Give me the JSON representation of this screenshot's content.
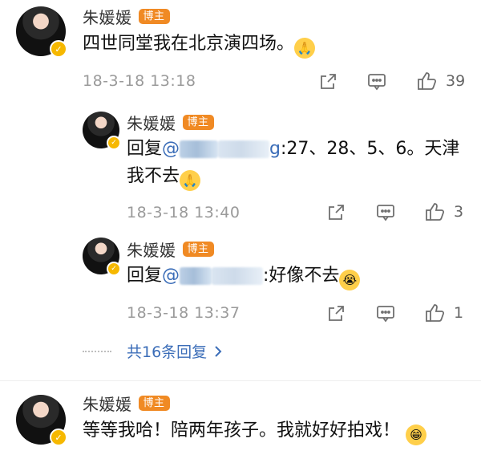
{
  "comments": [
    {
      "author": "朱媛媛",
      "tag": "博主",
      "text": "四世同堂我在北京演四场。",
      "emoji": "🙏",
      "time": "18-3-18 13:18",
      "likes": "39"
    }
  ],
  "replies": [
    {
      "author": "朱媛媛",
      "tag": "博主",
      "prefix": "回复",
      "mention": "@",
      "mention_tail": "g",
      "text": ":27、28、5、6。天津我不去",
      "emoji": "🙏",
      "time": "18-3-18 13:40",
      "likes": "3"
    },
    {
      "author": "朱媛媛",
      "tag": "博主",
      "prefix": "回复",
      "mention": "@",
      "text": ":好像不去",
      "emoji": "😭",
      "time": "18-3-18 13:37",
      "likes": "1"
    }
  ],
  "more_replies": "共16条回复",
  "comment2": {
    "author": "朱媛媛",
    "tag": "博主",
    "text": "等等我哈！陪两年孩子。我就好好拍戏！",
    "emoji": "😁"
  },
  "icons": {
    "share": "share-icon",
    "comment": "comment-icon",
    "like": "thumbs-up-icon",
    "verified": "verified-badge-icon"
  },
  "colors": {
    "tag": "#f08a24",
    "link": "#3b6db8",
    "verified": "#f6b800"
  }
}
